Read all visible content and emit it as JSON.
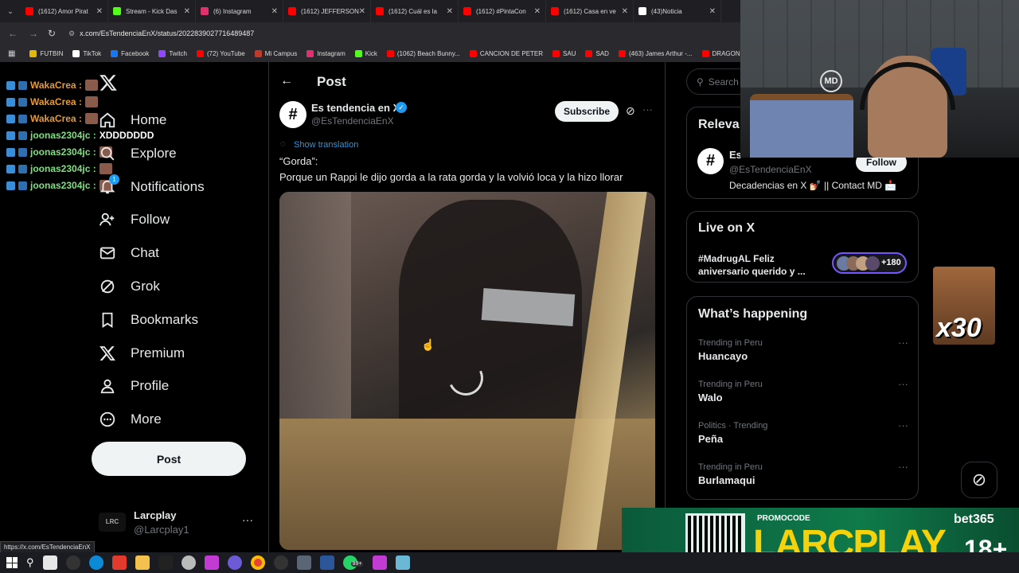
{
  "browser": {
    "tabs": [
      {
        "label": "(1612) Amor Pirat",
        "color": "#ff0000"
      },
      {
        "label": "Stream - Kick Das",
        "color": "#53fc18"
      },
      {
        "label": "(6) Instagram",
        "color": "#e1306c"
      },
      {
        "label": "(1612) JEFFERSON",
        "color": "#ff0000"
      },
      {
        "label": "(1612) Cuál es la",
        "color": "#ff0000"
      },
      {
        "label": "(1612) #PintaCon",
        "color": "#ff0000"
      },
      {
        "label": "(1612) Casa en ve",
        "color": "#ff0000"
      },
      {
        "label": "(43)Noticia",
        "color": "#ffffff"
      }
    ],
    "url": "x.com/EsTendenciaEnX/status/2022839027716489487",
    "bookmarks": [
      {
        "label": "FUTBIN",
        "color": "#e6b800"
      },
      {
        "label": "TikTok",
        "color": "#ffffff"
      },
      {
        "label": "Facebook",
        "color": "#1877f2"
      },
      {
        "label": "Twitch",
        "color": "#9146ff"
      },
      {
        "label": "(72) YouTube",
        "color": "#ff0000"
      },
      {
        "label": "Mi Campus",
        "color": "#c0392b"
      },
      {
        "label": "Instagram",
        "color": "#e1306c"
      },
      {
        "label": "Kick",
        "color": "#53fc18"
      },
      {
        "label": "(1062) Beach Bunny...",
        "color": "#ff0000"
      },
      {
        "label": "CANCION DE PETER",
        "color": "#ff0000"
      },
      {
        "label": "SAU",
        "color": "#ff0000"
      },
      {
        "label": "SAD",
        "color": "#ff0000"
      },
      {
        "label": "(463) James Arthur -...",
        "color": "#ff0000"
      },
      {
        "label": "DRAGON BAL",
        "color": "#ff0000"
      }
    ],
    "status_url": "https://x.com/EsTendenciaEnX"
  },
  "chat": [
    {
      "user": "WakaCrea :",
      "msg": "",
      "color": "#e89a2c"
    },
    {
      "user": "WakaCrea :",
      "msg": "",
      "color": "#e89a2c"
    },
    {
      "user": "WakaCrea :",
      "msg": "",
      "color": "#e89a2c"
    },
    {
      "user": "joonas2304jc :",
      "msg": "XDDDDDDD",
      "color": "#7fe07f"
    },
    {
      "user": "joonas2304jc :",
      "msg": "",
      "color": "#7fe07f"
    },
    {
      "user": "joonas2304jc :",
      "msg": "",
      "color": "#7fe07f"
    },
    {
      "user": "joonas2304jc :",
      "msg": "",
      "color": "#7fe07f"
    }
  ],
  "nav": {
    "items": [
      {
        "label": "Home",
        "icon": "home-icon"
      },
      {
        "label": "Explore",
        "icon": "search-icon"
      },
      {
        "label": "Notifications",
        "icon": "bell-icon"
      },
      {
        "label": "Follow",
        "icon": "follow-icon"
      },
      {
        "label": "Chat",
        "icon": "mail-icon"
      },
      {
        "label": "Grok",
        "icon": "grok-icon"
      },
      {
        "label": "Bookmarks",
        "icon": "bookmark-icon"
      },
      {
        "label": "Premium",
        "icon": "x-logo-icon"
      },
      {
        "label": "Profile",
        "icon": "person-icon"
      },
      {
        "label": "More",
        "icon": "more-circle-icon"
      }
    ],
    "notification_badge": "1",
    "post_button": "Post",
    "account_name": "Larcplay",
    "account_handle": "@Larcplay1"
  },
  "post": {
    "header": "Post",
    "author_name": "Es tendencia en X",
    "author_handle": "@EsTendenciaEnX",
    "subscribe": "Subscribe",
    "translate": "Show translation",
    "text_line1": "“Gorda”:",
    "text_line2": "Porque un Rappi le dijo gorda a la rata gorda y la volvió loca y la hizo llorar"
  },
  "sidebar": {
    "search_placeholder": "Search",
    "relevant_title": "Releva",
    "relevant_name": "Es",
    "relevant_handle": "@EsTendenciaEnX",
    "relevant_bio": "Decadencias en X 💅🏻 || Contact MD 📩",
    "follow": "Follow",
    "live_title": "Live on X",
    "live_text_1": "#MadrugAL Feliz",
    "live_text_2": "aniversario  querido y ...",
    "live_count": "+180",
    "happening_title": "What’s happening",
    "trends": [
      {
        "context": "Trending in Peru",
        "name": "Huancayo"
      },
      {
        "context": "Trending in Peru",
        "name": "Walo"
      },
      {
        "context": "Politics · Trending",
        "name": "Peña"
      },
      {
        "context": "Trending in Peru",
        "name": "Burlamaqui"
      }
    ]
  },
  "overlay": {
    "emote_count": "x30",
    "promo_label": "PROMOCODE",
    "promo_code": "LARCPLAY",
    "bet_brand": "bet365",
    "age": "18+"
  },
  "taskbar": {
    "whatsapp_badge": "99+"
  }
}
